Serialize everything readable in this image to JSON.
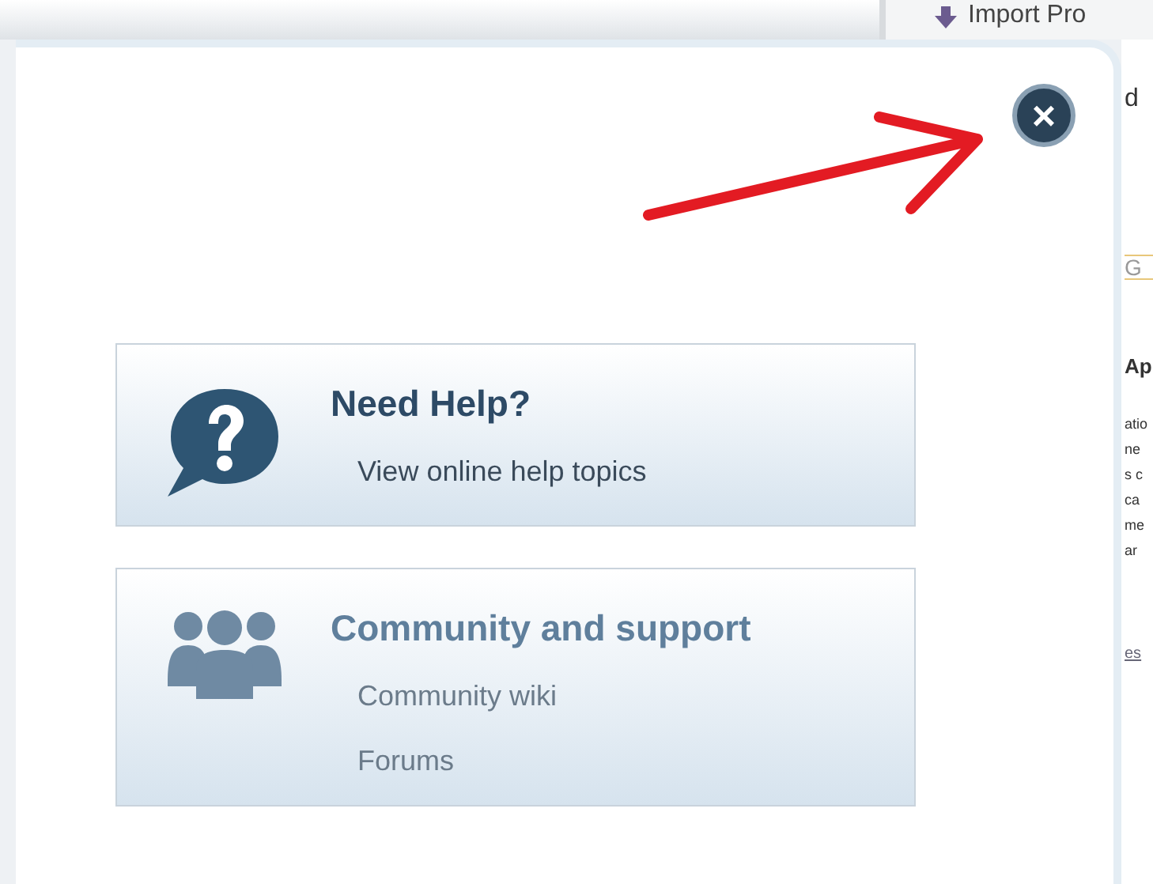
{
  "background": {
    "toolbar_button": "Import Pro",
    "fragments": [
      "d",
      "G",
      "Ap",
      "atio",
      "ne",
      "s c",
      "ca",
      "me",
      "ar",
      "es"
    ]
  },
  "dialog": {
    "close_label": "×",
    "cards": [
      {
        "kind": "help",
        "title": "Need Help?",
        "links": [
          "View online help topics"
        ]
      },
      {
        "kind": "community",
        "title": "Community and support",
        "links": [
          "Community wiki",
          "Forums"
        ]
      }
    ]
  }
}
